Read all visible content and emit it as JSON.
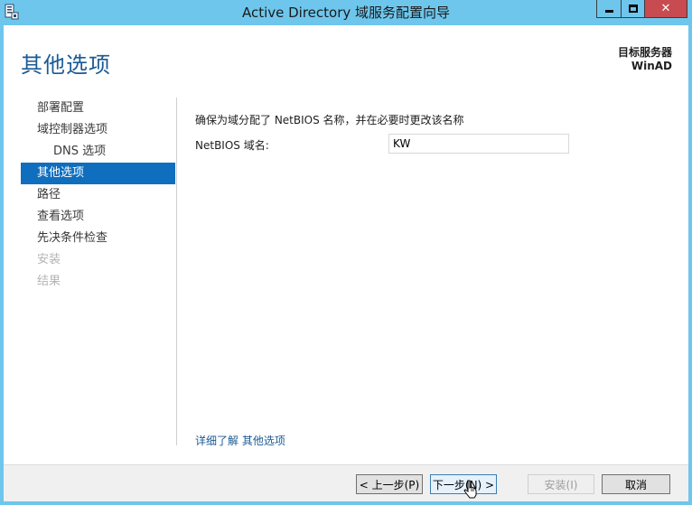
{
  "window": {
    "title": "Active Directory 域服务配置向导",
    "close_symbol": "✕"
  },
  "header": {
    "page_title": "其他选项",
    "target_server_label": "目标服务器",
    "target_server_name": "WinAD"
  },
  "nav": {
    "items": [
      {
        "label": "部署配置",
        "state": "normal"
      },
      {
        "label": "域控制器选项",
        "state": "normal"
      },
      {
        "label": "DNS 选项",
        "state": "sub"
      },
      {
        "label": "其他选项",
        "state": "active"
      },
      {
        "label": "路径",
        "state": "normal"
      },
      {
        "label": "查看选项",
        "state": "normal"
      },
      {
        "label": "先决条件检查",
        "state": "normal"
      },
      {
        "label": "安装",
        "state": "disabled"
      },
      {
        "label": "结果",
        "state": "disabled"
      }
    ]
  },
  "main": {
    "description": "确保为域分配了 NetBIOS 名称，并在必要时更改该名称",
    "netbios_label": "NetBIOS 域名:",
    "netbios_value": "KW",
    "learn_more": "详细了解 其他选项"
  },
  "footer": {
    "prev_label": "< 上一步(P)",
    "next_label": "下一步(N) >",
    "install_label": "安装(I)",
    "cancel_label": "取消"
  },
  "colors": {
    "titlebar": "#6ec6ec",
    "accent": "#106ebe",
    "page_title": "#1a5a96",
    "close_button": "#c74b50"
  }
}
